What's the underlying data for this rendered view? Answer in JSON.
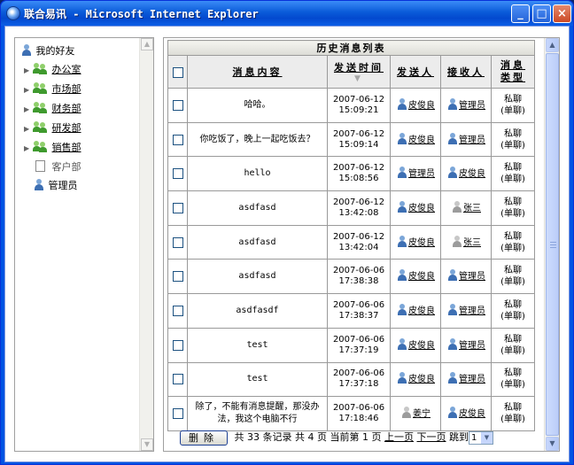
{
  "window": {
    "title": "联合易讯 - Microsoft Internet Explorer",
    "minimize": "_",
    "maximize": "□",
    "close": "×"
  },
  "sidebar": {
    "root": "我的好友",
    "items": [
      {
        "label": "办公室",
        "expandable": true,
        "active": true
      },
      {
        "label": "市场部",
        "expandable": true,
        "active": true
      },
      {
        "label": "财务部",
        "expandable": true,
        "active": true
      },
      {
        "label": "研发部",
        "expandable": true,
        "active": true
      },
      {
        "label": "销售部",
        "expandable": true,
        "active": true
      },
      {
        "label": "客户部",
        "expandable": false,
        "active": false
      },
      {
        "label": "管理员",
        "expandable": false,
        "active": false
      }
    ]
  },
  "table": {
    "title": "历史消息列表",
    "columns": {
      "content": "消息内容",
      "time": "发送时间",
      "sender": "发送人",
      "receiver": "接收人",
      "type_line1": "消息",
      "type_line2": "类型"
    },
    "rows": [
      {
        "content": "哈哈。",
        "date": "2007-06-12",
        "time": "15:09:21",
        "sender": "皮俊良",
        "receiver": "管理员",
        "type1": "私聊",
        "type2": "(单聊)"
      },
      {
        "content": "你吃饭了，晚上一起吃饭去？",
        "date": "2007-06-12",
        "time": "15:09:14",
        "sender": "皮俊良",
        "receiver": "管理员",
        "type1": "私聊",
        "type2": "(单聊)"
      },
      {
        "content": "hello",
        "date": "2007-06-12",
        "time": "15:08:56",
        "sender": "管理员",
        "receiver": "皮俊良",
        "type1": "私聊",
        "type2": "(单聊)"
      },
      {
        "content": "asdfasd",
        "date": "2007-06-12",
        "time": "13:42:08",
        "sender": "皮俊良",
        "receiver": "张三",
        "type1": "私聊",
        "type2": "(单聊)"
      },
      {
        "content": "asdfasd",
        "date": "2007-06-12",
        "time": "13:42:04",
        "sender": "皮俊良",
        "receiver": "张三",
        "type1": "私聊",
        "type2": "(单聊)"
      },
      {
        "content": "asdfasd",
        "date": "2007-06-06",
        "time": "17:38:38",
        "sender": "皮俊良",
        "receiver": "管理员",
        "type1": "私聊",
        "type2": "(单聊)"
      },
      {
        "content": "asdfasdf",
        "date": "2007-06-06",
        "time": "17:38:37",
        "sender": "皮俊良",
        "receiver": "管理员",
        "type1": "私聊",
        "type2": "(单聊)"
      },
      {
        "content": "test",
        "date": "2007-06-06",
        "time": "17:37:19",
        "sender": "皮俊良",
        "receiver": "管理员",
        "type1": "私聊",
        "type2": "(单聊)"
      },
      {
        "content": "test",
        "date": "2007-06-06",
        "time": "17:37:18",
        "sender": "皮俊良",
        "receiver": "管理员",
        "type1": "私聊",
        "type2": "(单聊)"
      },
      {
        "content": "除了，不能有消息提醒，那没办法，我这个电脑不行",
        "date": "2007-06-06",
        "time": "17:18:46",
        "sender": "姜宁",
        "receiver": "皮俊良",
        "type1": "私聊",
        "type2": "(单聊)"
      }
    ]
  },
  "footer": {
    "delete_button": "删除",
    "total_prefix": "共",
    "total_count": "33",
    "total_suffix": "条记录",
    "pages_prefix": "共",
    "pages_count": "4",
    "pages_suffix": "页",
    "current_prefix": "当前第",
    "current_page": "1",
    "current_suffix": "页",
    "prev": "上一页",
    "next": "下一页",
    "jump": "跳到",
    "jump_value": "1"
  }
}
